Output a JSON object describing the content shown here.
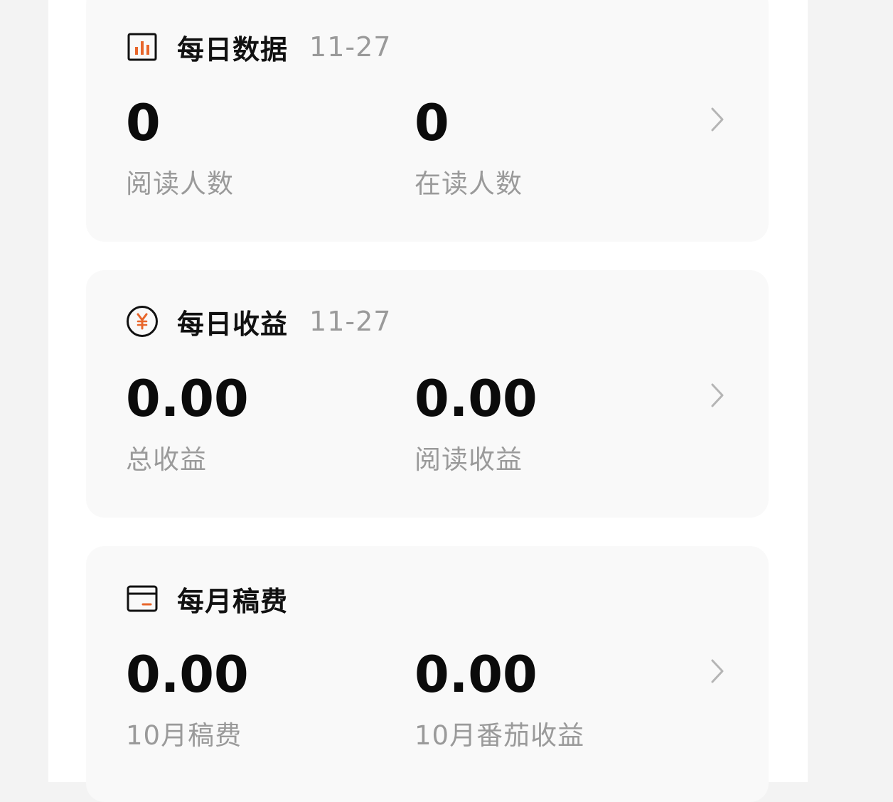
{
  "cards": [
    {
      "title": "每日数据",
      "date": "11-27",
      "icon": "bar-chart-icon",
      "metrics": [
        {
          "value": "0",
          "label": "阅读人数"
        },
        {
          "value": "0",
          "label": "在读人数"
        }
      ]
    },
    {
      "title": "每日收益",
      "date": "11-27",
      "icon": "yen-coin-icon",
      "metrics": [
        {
          "value": "0.00",
          "label": "总收益"
        },
        {
          "value": "0.00",
          "label": "阅读收益"
        }
      ]
    },
    {
      "title": "每月稿费",
      "date": "",
      "icon": "wallet-card-icon",
      "metrics": [
        {
          "value": "0.00",
          "label": "10月稿费"
        },
        {
          "value": "0.00",
          "label": "10月番茄收益"
        }
      ]
    }
  ],
  "colors": {
    "accent": "#e8662b",
    "card_bg": "#f9f9f9",
    "text_primary": "#0b0b0b",
    "text_secondary": "#9a9a9a"
  }
}
